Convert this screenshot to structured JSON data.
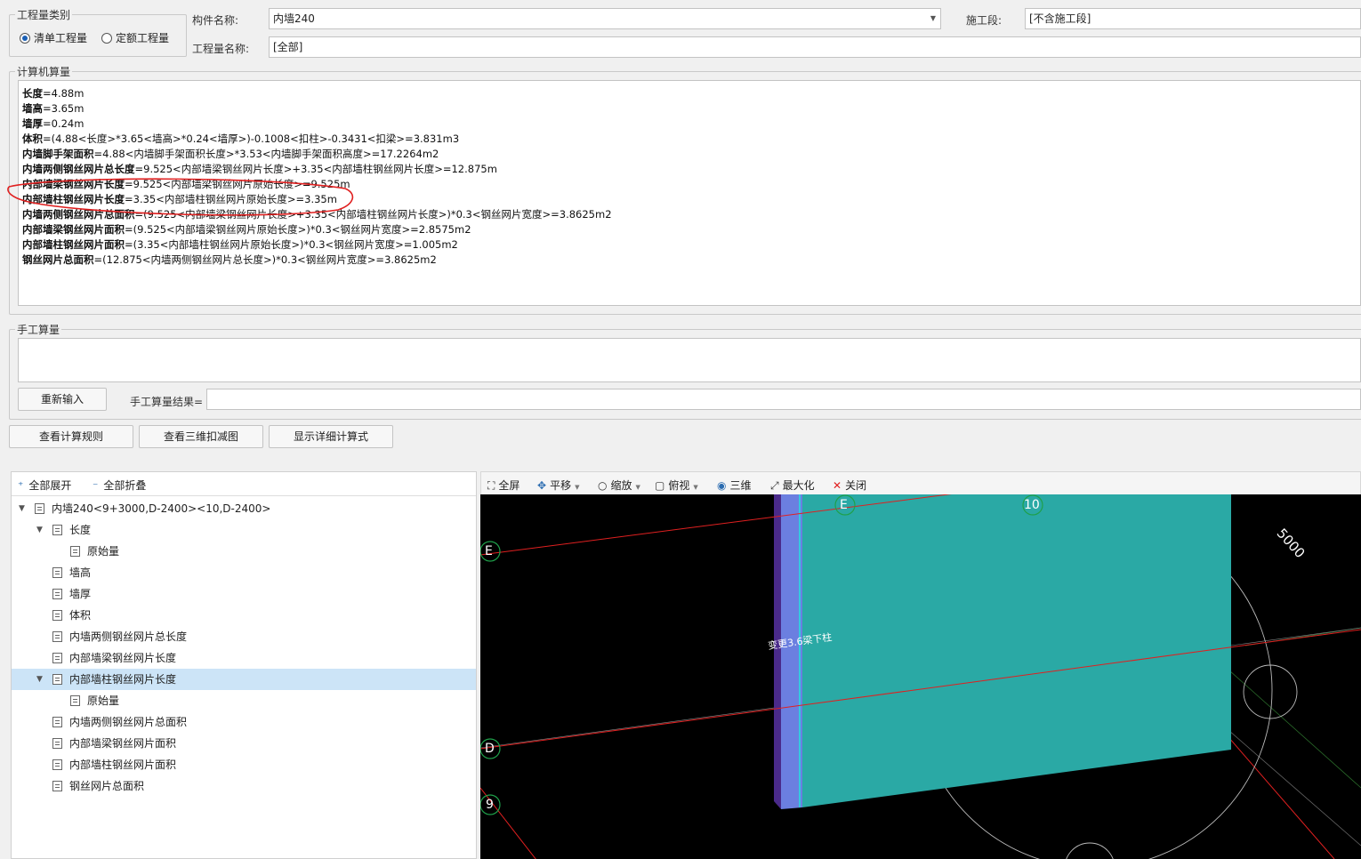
{
  "top": {
    "category_legend": "工程量类别",
    "radio_qingdan": "清单工程量",
    "radio_dinge": "定额工程量",
    "component_label": "构件名称:",
    "component_value": "内墙240",
    "stage_label": "施工段:",
    "stage_value": "[不含施工段]",
    "qty_name_label": "工程量名称:",
    "qty_name_value": "[全部]"
  },
  "calc": {
    "legend": "计算机算量",
    "lines": [
      {
        "name": "长度",
        "expr": "=4.88m"
      },
      {
        "name": "墙高",
        "expr": "=3.65m"
      },
      {
        "name": "墙厚",
        "expr": "=0.24m"
      },
      {
        "name": "体积",
        "expr": "=(4.88<长度>*3.65<墙高>*0.24<墙厚>)-0.1008<扣柱>-0.3431<扣梁>=3.831m3"
      },
      {
        "name": "内墙脚手架面积",
        "expr": "=4.88<内墙脚手架面积长度>*3.53<内墙脚手架面积高度>=17.2264m2"
      },
      {
        "name": "内墙两侧钢丝网片总长度",
        "expr": "=9.525<内部墙梁钢丝网片长度>+3.35<内部墙柱钢丝网片长度>=12.875m"
      },
      {
        "name": "内部墙梁钢丝网片长度",
        "expr": "=9.525<内部墙梁钢丝网片原始长度>=9.525m"
      },
      {
        "name": "内部墙柱钢丝网片长度",
        "expr": "=3.35<内部墙柱钢丝网片原始长度>=3.35m"
      },
      {
        "name": "内墙两侧钢丝网片总面积",
        "expr": "=(9.525<内部墙梁钢丝网片长度>+3.35<内部墙柱钢丝网片长度>)*0.3<钢丝网片宽度>=3.8625m2"
      },
      {
        "name": "内部墙梁钢丝网片面积",
        "expr": "=(9.525<内部墙梁钢丝网片原始长度>)*0.3<钢丝网片宽度>=2.8575m2"
      },
      {
        "name": "内部墙柱钢丝网片面积",
        "expr": "=(3.35<内部墙柱钢丝网片原始长度>)*0.3<钢丝网片宽度>=1.005m2"
      },
      {
        "name": "钢丝网片总面积",
        "expr": "=(12.875<内墙两侧钢丝网片总长度>)*0.3<钢丝网片宽度>=3.8625m2"
      }
    ]
  },
  "manual": {
    "legend": "手工算量",
    "reinput_button": "重新输入",
    "result_label": "手工算量结果="
  },
  "actions": {
    "view_rules": "查看计算规则",
    "view_3d": "查看三维扣减图",
    "show_detail": "显示详细计算式"
  },
  "tree": {
    "expand_all": "全部展开",
    "collapse_all": "全部折叠",
    "root": "内墙240<9+3000,D-2400><10,D-2400>",
    "items": [
      "长度",
      "原始量",
      "墙高",
      "墙厚",
      "体积",
      "内墙两侧钢丝网片总长度",
      "内部墙梁钢丝网片长度",
      "内部墙柱钢丝网片长度",
      "原始量",
      "内墙两侧钢丝网片总面积",
      "内部墙梁钢丝网片面积",
      "内部墙柱钢丝网片面积",
      "钢丝网片总面积"
    ]
  },
  "viewer": {
    "tools": [
      "全屏",
      "平移",
      "缩放",
      "俯视",
      "三维",
      "最大化",
      "关闭"
    ],
    "axis_E_top": "E",
    "axis_10": "10",
    "axis_E_left": "E",
    "axis_D": "D",
    "axis_9": "9",
    "dim_5000": "5000",
    "wall_note": "变更3.6梁下柱"
  },
  "colors": {
    "wall_face": "#2aa9a5",
    "wall_edge": "#6b7fe0",
    "wall_dark": "#4a2a8a",
    "annotation_red": "#e02020",
    "selection": "#cce4f7"
  }
}
